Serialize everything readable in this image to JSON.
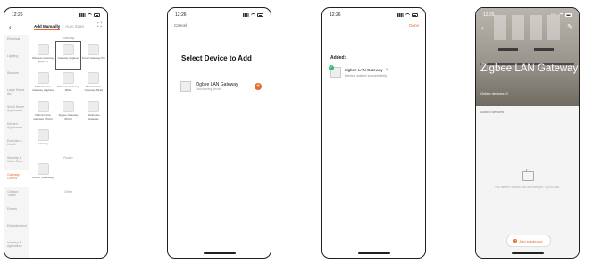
{
  "phone1": {
    "time": "12:26",
    "tabs": [
      "Add Manually",
      "Auto Scan"
    ],
    "categories": [
      "Electrical",
      "Lighting",
      "Sensors",
      "Large Home Ap.",
      "Small Home Appliances",
      "Kitchen Appliances",
      "Exercise & Health",
      "Security & Video Surv.",
      "Gateway Control",
      "Outdoor Travel",
      "Energy",
      "Entertainment",
      "Industry & Agriculture"
    ],
    "selected_category": "Gateway Control",
    "section1": "Gateway",
    "gateway_items": [
      "Wireless Gateway (Zigbee)",
      "Gateway (Zigbee)",
      "Smart Gateway Pro",
      "Multi-function Gateway (Zigbee)",
      "Wireless Gateway (BLE)",
      "Multi-function Gateway (BLE)",
      "Multi-function Gateway (Wi-Fi)",
      "Zigbee Gateway (Wi-Fi)",
      "Multimode Gateway",
      "Gateway"
    ],
    "section2": "Router",
    "router_items": [
      "Router (Gateway)"
    ],
    "section3": "Other"
  },
  "phone2": {
    "time": "12:26",
    "cancel": "Cancel",
    "title": "Select Device to Add",
    "device_name": "Zigbee LAN Gateway",
    "device_status": "Discovering device",
    "add_symbol": "+"
  },
  "phone3": {
    "time": "12:26",
    "done": "Done",
    "added_label": "Added:",
    "device_name": "Zigbee LAN Gateway",
    "device_status": "Device added successfully"
  },
  "phone4": {
    "time": "12:26",
    "title": "Zigbee LAN Gateway",
    "online": "Online devices: 0",
    "added_devices": "Added devices",
    "empty_text": "You haven't added sub-devices yet. Tap to add.",
    "add_button": "Add subdevice",
    "add_symbol": "+"
  },
  "accent_color": "#e56a2c",
  "success_color": "#2bb673"
}
